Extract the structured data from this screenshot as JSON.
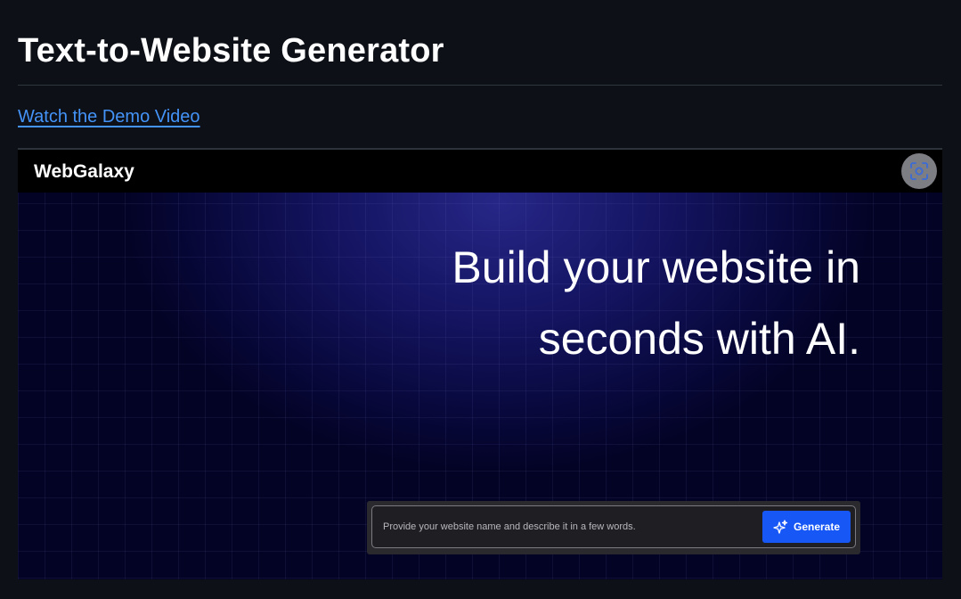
{
  "page": {
    "title": "Text-to-Website Generator",
    "demo_link": "Watch the Demo Video"
  },
  "preview": {
    "brand": "WebGalaxy",
    "capture_icon": "screenshot-capture-icon",
    "headline_line1": "Build your website in",
    "headline_line2": "seconds with AI.",
    "prompt_placeholder": "Provide your website name and describe it in a few words.",
    "generate_label": "Generate",
    "generate_icon": "sparkles-icon"
  },
  "colors": {
    "background": "#0d1117",
    "link": "#4493f8",
    "preview_bg": "#050530",
    "generate_button": "#1757f5"
  }
}
